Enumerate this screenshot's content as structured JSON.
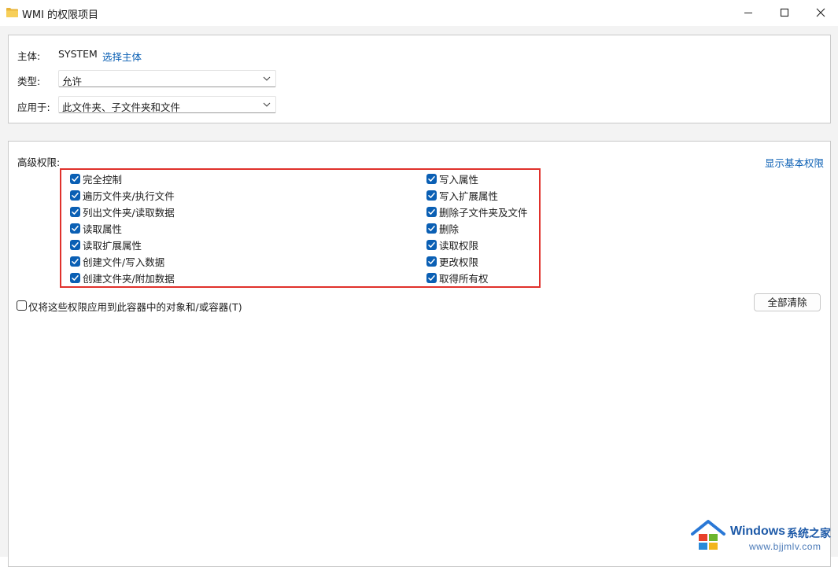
{
  "window": {
    "title": "WMI 的权限项目",
    "controls": {
      "minimize": "minimize-icon",
      "maximize": "maximize-icon",
      "close": "close-icon"
    }
  },
  "principal": {
    "label": "主体:",
    "value": "SYSTEM",
    "select_link": "选择主体"
  },
  "type": {
    "label": "类型:",
    "value": "允许"
  },
  "applies_to": {
    "label": "应用于:",
    "value": "此文件夹、子文件夹和文件"
  },
  "advanced": {
    "heading": "高级权限:",
    "show_basic_link": "显示基本权限",
    "left_permissions": [
      {
        "label": "完全控制",
        "checked": true
      },
      {
        "label": "遍历文件夹/执行文件",
        "checked": true
      },
      {
        "label": "列出文件夹/读取数据",
        "checked": true
      },
      {
        "label": "读取属性",
        "checked": true
      },
      {
        "label": "读取扩展属性",
        "checked": true
      },
      {
        "label": "创建文件/写入数据",
        "checked": true
      },
      {
        "label": "创建文件夹/附加数据",
        "checked": true
      }
    ],
    "right_permissions": [
      {
        "label": "写入属性",
        "checked": true
      },
      {
        "label": "写入扩展属性",
        "checked": true
      },
      {
        "label": "删除子文件夹及文件",
        "checked": true
      },
      {
        "label": "删除",
        "checked": true
      },
      {
        "label": "读取权限",
        "checked": true
      },
      {
        "label": "更改权限",
        "checked": true
      },
      {
        "label": "取得所有权",
        "checked": true
      }
    ],
    "apply_only_container": {
      "label": "仅将这些权限应用到此容器中的对象和/或容器(T)",
      "checked": false
    },
    "clear_all_button": "全部清除"
  },
  "watermark": {
    "brand": "Windows",
    "brand_cn": "系统之家",
    "url": "www.bjjmlv.com"
  },
  "colors": {
    "accent": "#0a5fb4",
    "highlight_border": "#e0312c"
  }
}
